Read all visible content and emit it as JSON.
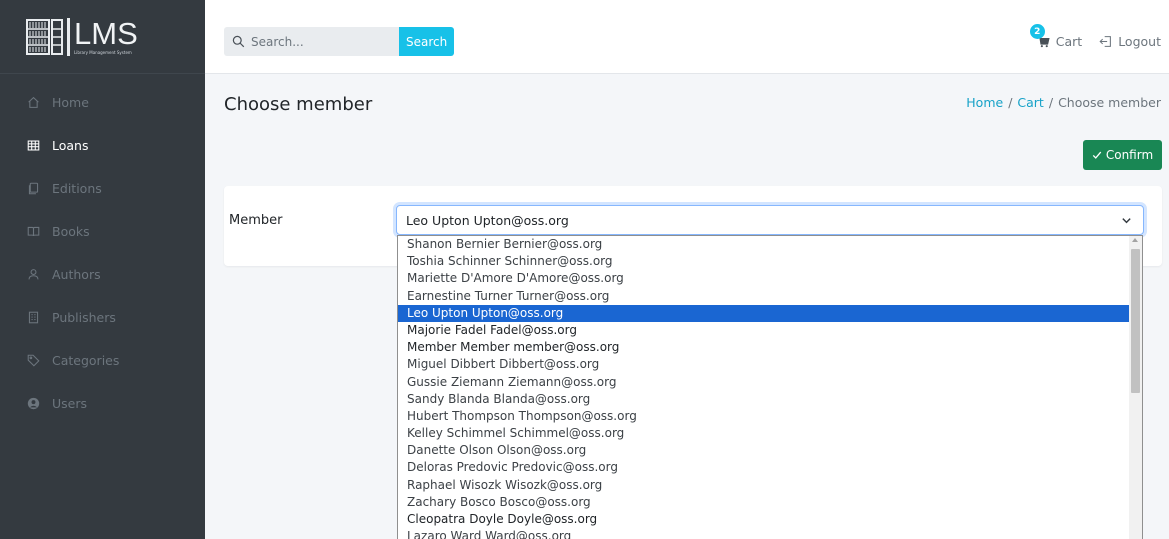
{
  "logo": {
    "title": "LMS",
    "subtitle": "Library Management System"
  },
  "sidebar": {
    "items": [
      {
        "label": "Home",
        "icon": "home-icon",
        "active": false
      },
      {
        "label": "Loans",
        "icon": "table-icon",
        "active": true
      },
      {
        "label": "Editions",
        "icon": "copy-icon",
        "active": false
      },
      {
        "label": "Books",
        "icon": "book-open-icon",
        "active": false
      },
      {
        "label": "Authors",
        "icon": "person-icon",
        "active": false
      },
      {
        "label": "Publishers",
        "icon": "building-icon",
        "active": false
      },
      {
        "label": "Categories",
        "icon": "tag-icon",
        "active": false
      },
      {
        "label": "Users",
        "icon": "user-circle-icon",
        "active": false
      }
    ]
  },
  "topbar": {
    "search_placeholder": "Search...",
    "search_button": "Search",
    "cart_label": "Cart",
    "cart_count": "2",
    "logout_label": "Logout"
  },
  "page": {
    "title": "Choose member",
    "breadcrumb": {
      "home": "Home",
      "cart": "Cart",
      "current": "Choose member"
    },
    "confirm_label": "Confirm"
  },
  "form": {
    "member_label": "Member",
    "selected_member": "Leo Upton Upton@oss.org",
    "options": [
      "Shanon Bernier Bernier@oss.org",
      "Toshia Schinner Schinner@oss.org",
      "Mariette D'Amore D'Amore@oss.org",
      "Earnestine Turner Turner@oss.org",
      "Leo Upton Upton@oss.org",
      "Majorie Fadel Fadel@oss.org",
      "Member Member member@oss.org",
      "Miguel Dibbert Dibbert@oss.org",
      "Gussie Ziemann Ziemann@oss.org",
      "Sandy Blanda Blanda@oss.org",
      "Hubert Thompson Thompson@oss.org",
      "Kelley Schimmel Schimmel@oss.org",
      "Danette Olson Olson@oss.org",
      "Deloras Predovic Predovic@oss.org",
      "Raphael Wisozk Wisozk@oss.org",
      "Zachary Bosco Bosco@oss.org",
      "Cleopatra Doyle Doyle@oss.org",
      "Lazaro Ward Ward@oss.org"
    ],
    "selected_index": 4
  },
  "colors": {
    "sidebar_bg": "#343a40",
    "accent": "#17c1e8",
    "confirm": "#198754",
    "selected_option": "#1a66d2"
  }
}
